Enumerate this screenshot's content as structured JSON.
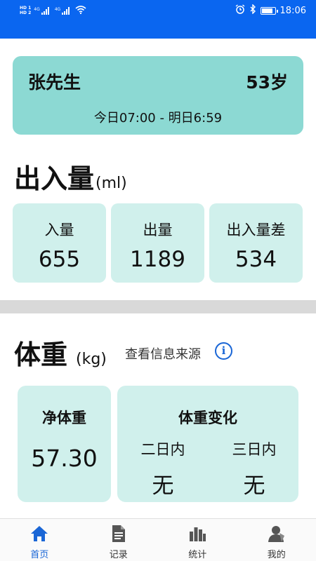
{
  "status_bar": {
    "sim1": "HD 1",
    "sim2": "HD 2",
    "signal1": "4G",
    "signal2": "4G",
    "time": "18:06",
    "battery_level": 0.85,
    "icons": [
      "alarm-icon",
      "bluetooth-icon",
      "battery-icon",
      "wifi-icon"
    ]
  },
  "patient": {
    "name": "张先生",
    "age": "53岁",
    "period": "今日07:00 - 明日6:59"
  },
  "io_section": {
    "title": "出入量",
    "unit": "(ml)",
    "cards": [
      {
        "label": "入量",
        "value": "655"
      },
      {
        "label": "出量",
        "value": "1189"
      },
      {
        "label": "出入量差",
        "value": "534"
      }
    ]
  },
  "weight_section": {
    "title": "体重",
    "unit": "(kg)",
    "info_link": "查看信息来源",
    "net_label": "净体重",
    "net_value": "57.30",
    "change_title": "体重变化",
    "two_day_label": "二日内",
    "two_day_value": "无",
    "three_day_label": "三日内",
    "three_day_value": "无"
  },
  "nav": {
    "items": [
      {
        "label": "首页",
        "icon": "home-icon",
        "active": true
      },
      {
        "label": "记录",
        "icon": "document-icon",
        "active": false
      },
      {
        "label": "统计",
        "icon": "bar-chart-icon",
        "active": false
      },
      {
        "label": "我的",
        "icon": "user-icon",
        "active": false
      }
    ]
  },
  "colors": {
    "accent": "#0a66f0",
    "patient_card": "#8cd9d3",
    "card_bg": "#d0f0ec",
    "nav_active": "#1a66d6"
  }
}
